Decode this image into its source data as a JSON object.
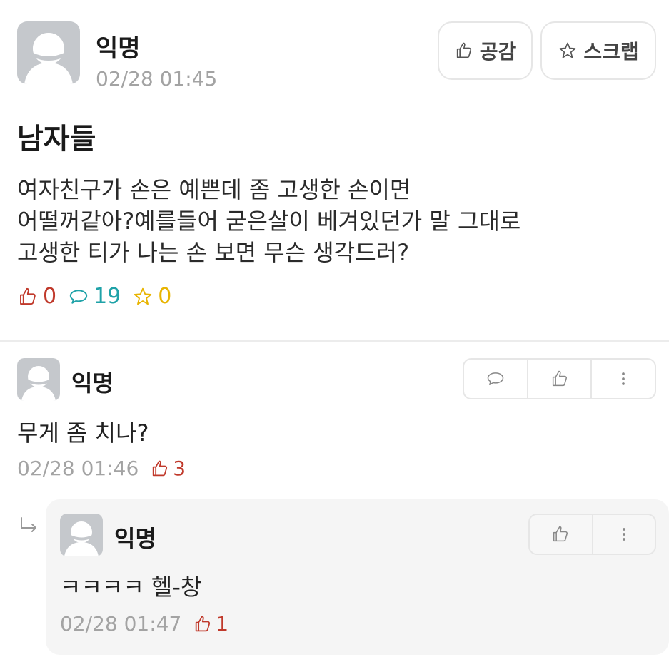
{
  "colors": {
    "like": "#c0392b",
    "comment": "#1fa2a8",
    "scrap": "#e8b400",
    "muted": "#a3a3a3",
    "border": "#e6e6e6",
    "avatar": "#c5c8cc"
  },
  "post": {
    "author": "익명",
    "time": "02/28 01:45",
    "like_button_label": "공감",
    "scrap_button_label": "스크랩",
    "title": "남자들",
    "body": "여자친구가 손은 예쁜데 좀 고생한 손이면\n어떨꺼같아?예를들어 굳은살이 베겨있던가 말 그대로\n고생한 티가 나는 손 보면 무슨 생각드러?",
    "stats": {
      "likes": "0",
      "comments": "19",
      "scraps": "0"
    },
    "icons": {
      "like": "thumbs-up-icon",
      "scrap": "star-icon",
      "comment": "speech-bubble-icon"
    }
  },
  "comment": {
    "author": "익명",
    "text": "무게 좀 치나?",
    "time": "02/28 01:46",
    "likes": "3",
    "icons": [
      "reply-bubble-icon",
      "thumbs-up-icon",
      "more-vertical-icon"
    ]
  },
  "reply": {
    "author": "익명",
    "text": "ㅋㅋㅋㅋ 헬-창",
    "time": "02/28 01:47",
    "likes": "1",
    "icons": [
      "thumbs-up-icon",
      "more-vertical-icon"
    ]
  }
}
